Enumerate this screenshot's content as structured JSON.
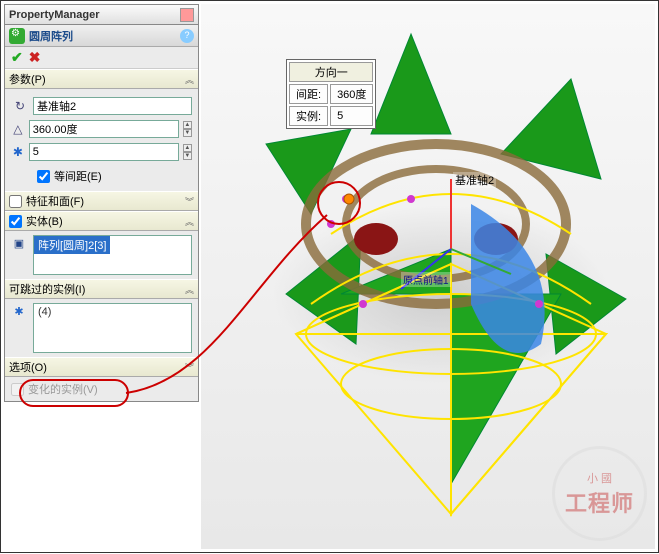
{
  "pm": {
    "title": "PropertyManager"
  },
  "feature": {
    "title": "圆周阵列",
    "help": "?"
  },
  "confirm": {
    "ok": "✔",
    "cancel": "✖"
  },
  "params": {
    "header": "参数(P)",
    "axis": "基准轴2",
    "angle": "360.00度",
    "count": "5",
    "equal_label": "等间距(E)",
    "equal_checked": true
  },
  "features_faces": {
    "header": "特征和面(F)",
    "checked": false
  },
  "bodies": {
    "header": "实体(B)",
    "checked": true,
    "item": "阵列[圆周]2[3]"
  },
  "skip": {
    "header": "可跳过的实例(I)",
    "item": "(4)"
  },
  "options": {
    "header": "选项(O)"
  },
  "varied": {
    "label": "变化的实例(V)",
    "checked": false
  },
  "callout": {
    "title": "方向一",
    "spacing_label": "间距:",
    "spacing": "360度",
    "count_label": "实例:",
    "count": "5"
  },
  "viewport": {
    "axis_label": "基准轴2",
    "origin_label": "原点前轴1"
  },
  "watermark": {
    "small": "小 國",
    "big": "工程师"
  }
}
